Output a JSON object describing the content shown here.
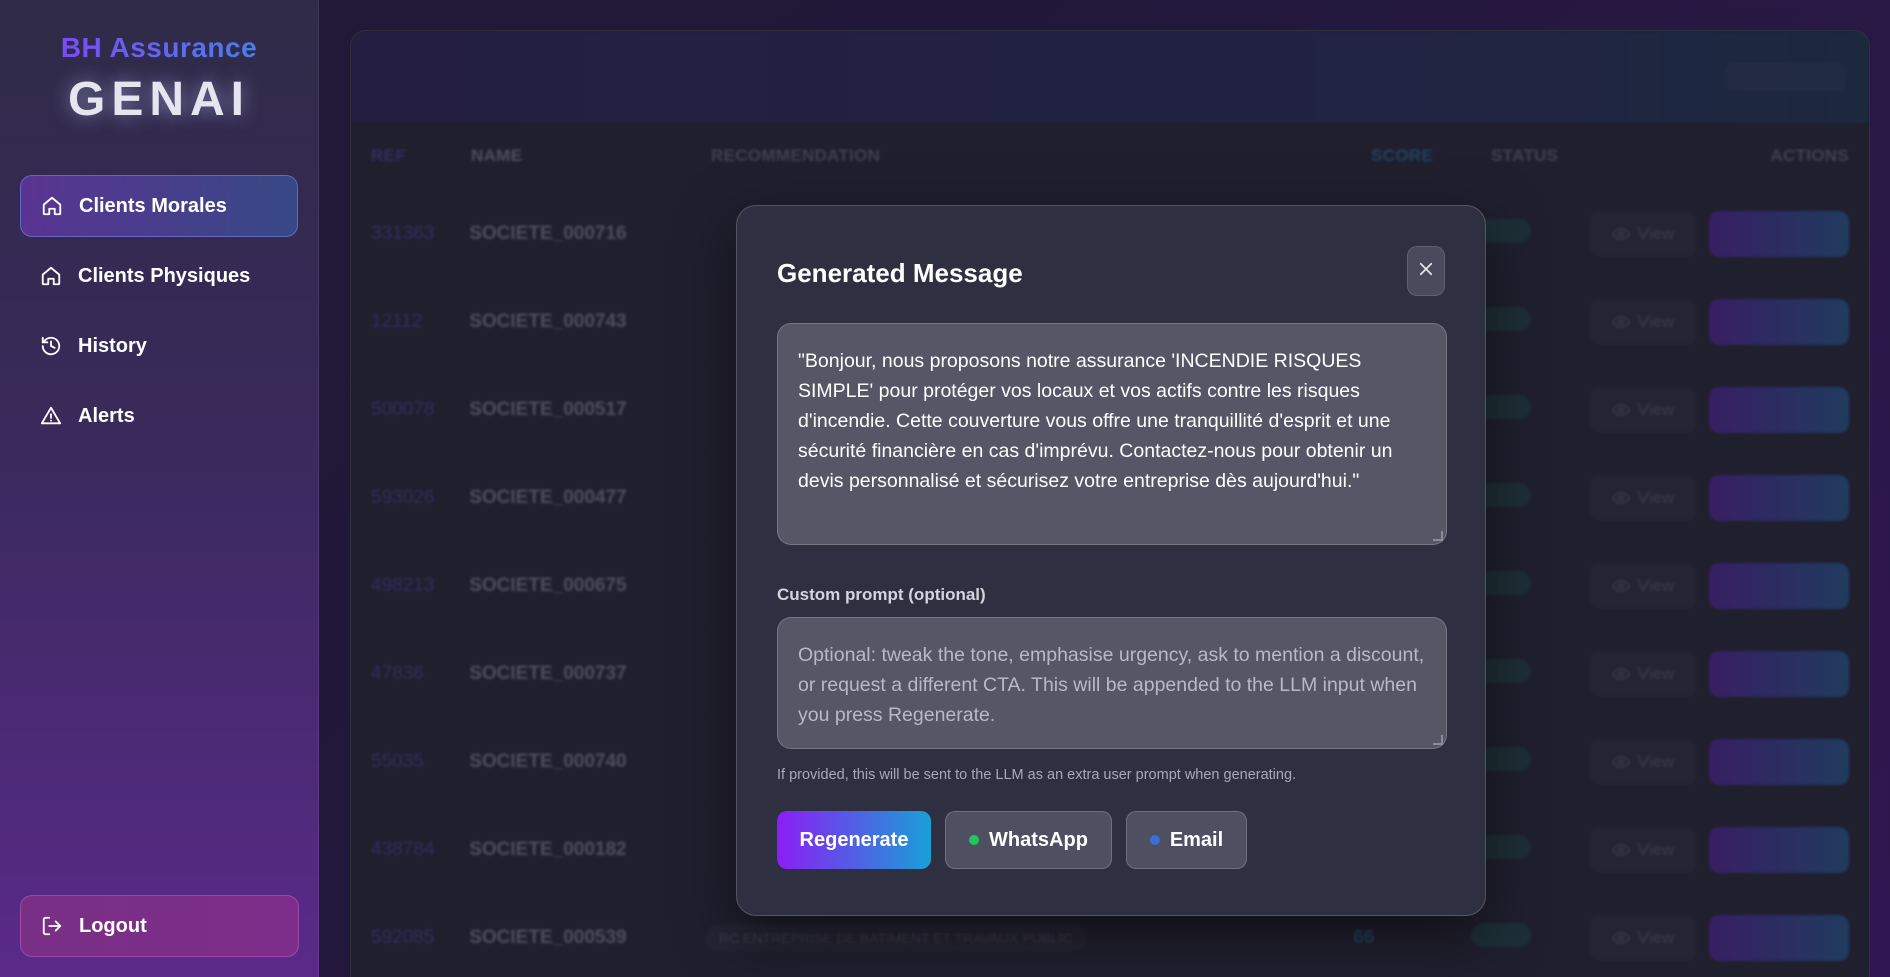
{
  "brand": {
    "top": "BH Assurance",
    "main": "GENAI"
  },
  "sidebar": {
    "items": [
      {
        "label": "Clients Morales",
        "icon": "home-icon",
        "active": true
      },
      {
        "label": "Clients Physiques",
        "icon": "home-icon",
        "active": false
      },
      {
        "label": "History",
        "icon": "history-icon",
        "active": false
      },
      {
        "label": "Alerts",
        "icon": "alert-triangle-icon",
        "active": false
      }
    ],
    "logout_label": "Logout"
  },
  "table": {
    "columns": [
      "REF",
      "NAME",
      "RECOMMENDATION",
      "SCORE",
      "STATUS",
      "ACTIONS"
    ],
    "view_label": "View",
    "rows": [
      {
        "ref": "331363",
        "name": "SOCIETE_000716",
        "rec": "",
        "score": ""
      },
      {
        "ref": "12112",
        "name": "SOCIETE_000743",
        "rec": "",
        "score": ""
      },
      {
        "ref": "500078",
        "name": "SOCIETE_000517",
        "rec": "",
        "score": ""
      },
      {
        "ref": "593026",
        "name": "SOCIETE_000477",
        "rec": "",
        "score": ""
      },
      {
        "ref": "498213",
        "name": "SOCIETE_000675",
        "rec": "",
        "score": ""
      },
      {
        "ref": "47836",
        "name": "SOCIETE_000737",
        "rec": "",
        "score": ""
      },
      {
        "ref": "55035",
        "name": "SOCIETE_000740",
        "rec": "",
        "score": ""
      },
      {
        "ref": "438784",
        "name": "SOCIETE_000182",
        "rec": "",
        "score": ""
      },
      {
        "ref": "592085",
        "name": "SOCIETE_000539",
        "rec": "RC ENTREPRISE DE BATIMENT ET TRAVAUX PUBLIC",
        "score": "66"
      }
    ]
  },
  "modal": {
    "title": "Generated Message",
    "message": "\"Bonjour, nous proposons notre assurance 'INCENDIE RISQUES SIMPLE' pour protéger vos locaux et vos actifs contre les risques d'incendie. Cette couverture vous offre une tranquillité d'esprit et une sécurité financière en cas d'imprévu. Contactez-nous pour obtenir un devis personnalisé et sécurisez votre entreprise dès aujourd'hui.\"",
    "prompt_label": "Custom prompt (optional)",
    "prompt_placeholder": "Optional: tweak the tone, emphasise urgency, ask to mention a discount, or request a different CTA. This will be appended to the LLM input when you press Regenerate.",
    "hint": "If provided, this will be sent to the LLM as an extra user prompt when generating.",
    "buttons": {
      "regenerate": "Regenerate",
      "whatsapp": "WhatsApp",
      "email": "Email"
    },
    "colors": {
      "whatsapp_dot": "#22c55e",
      "email_dot": "#3b6fd6"
    }
  }
}
